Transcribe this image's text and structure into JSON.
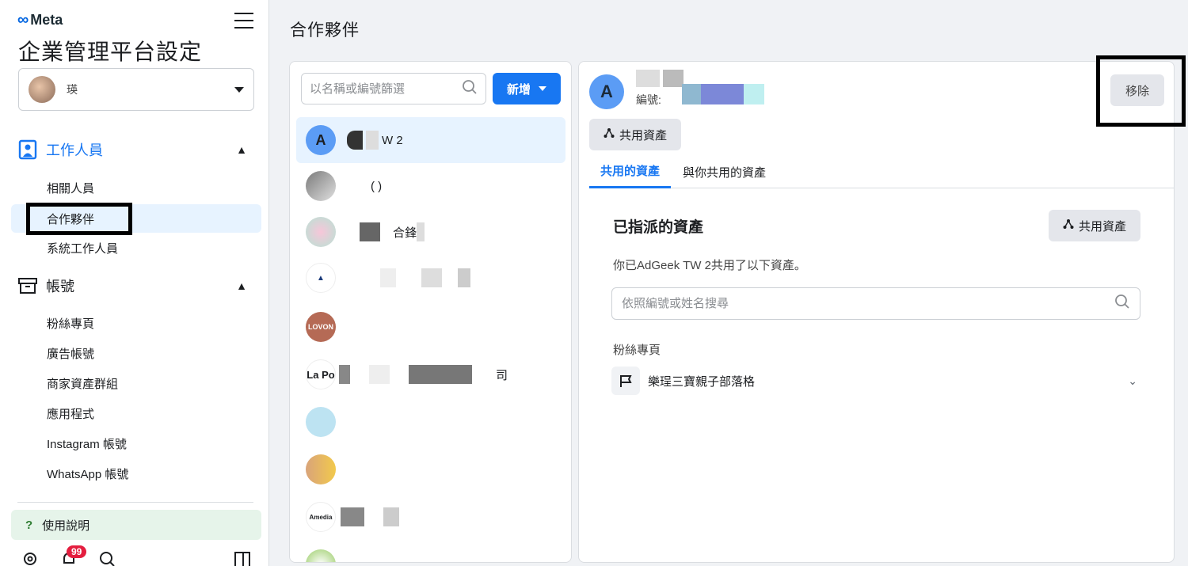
{
  "sidebar": {
    "logo": "Meta",
    "title": "企業管理平台設定",
    "account": {
      "name": "瑛"
    },
    "sections": {
      "people": {
        "label": "工作人員",
        "items": [
          "相關人員",
          "合作夥伴",
          "系統工作人員"
        ]
      },
      "accounts": {
        "label": "帳號",
        "items": [
          "粉絲專頁",
          "廣告帳號",
          "商家資產群組",
          "應用程式",
          "Instagram 帳號",
          "WhatsApp 帳號"
        ]
      }
    },
    "help": "使用說明",
    "notification_count": "99",
    "icons": [
      "gear-icon",
      "bell-icon",
      "search-icon",
      "panel-icon"
    ]
  },
  "page_title": "合作夥伴",
  "partner_list": {
    "search_placeholder": "以名稱或編號篩選",
    "add_label": "新增",
    "partners": [
      {
        "initial": "A",
        "name": "W 2",
        "selected": true
      },
      {
        "initial": "",
        "name": "(  )"
      },
      {
        "initial": "",
        "name": "合鋒"
      },
      {
        "initial": "",
        "name": ""
      },
      {
        "initial": "",
        "name": ""
      },
      {
        "initial": "",
        "name": "司"
      },
      {
        "initial": "",
        "name": ""
      },
      {
        "initial": "",
        "name": ""
      },
      {
        "initial": "",
        "name": ""
      }
    ]
  },
  "detail": {
    "avatar_initial": "A",
    "id_label": "編號:",
    "remove_label": "移除",
    "share_assets_label": "共用資產",
    "tabs": [
      "共用的資產",
      "與你共用的資產"
    ],
    "assigned_title": "已指派的資產",
    "shared_description": "你已AdGeek TW 2共用了以下資產。",
    "asset_search_placeholder": "依照編號或姓名搜尋",
    "category_label": "粉絲專頁",
    "asset_name": "樂珵三寶親子部落格"
  },
  "colors": {
    "accent": "#1877f2",
    "selected_bg": "#e7f3ff",
    "help_bg": "#e6f4ea",
    "badge": "#e41e3f"
  }
}
